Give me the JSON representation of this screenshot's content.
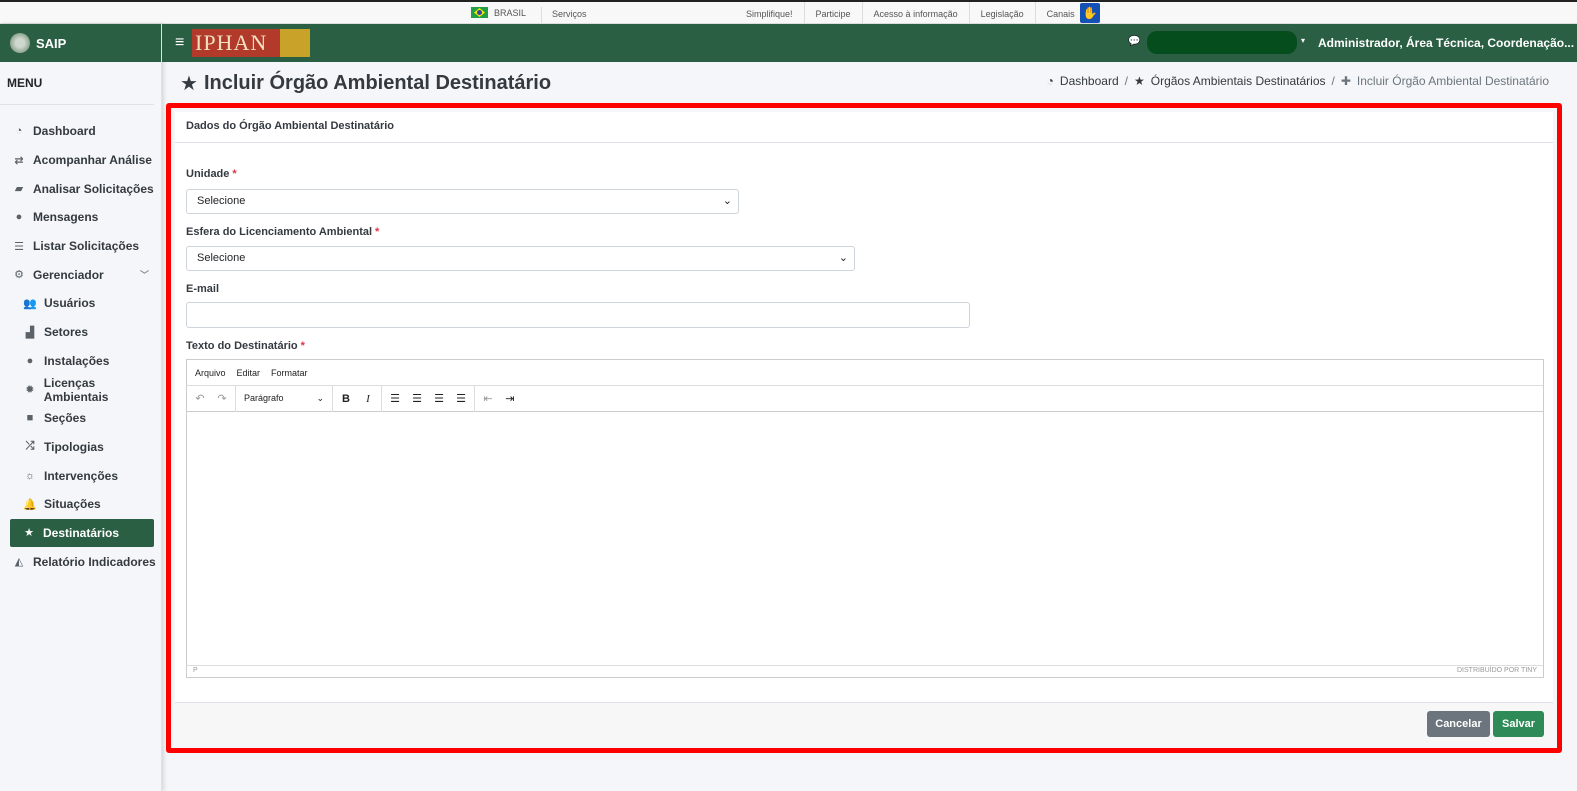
{
  "govbar": {
    "country": "BRASIL",
    "servicos": "Serviços",
    "links": [
      "Simplifique!",
      "Participe",
      "Acesso à informação",
      "Legislação",
      "Canais"
    ]
  },
  "brand": {
    "name": "SAIP"
  },
  "sidebar": {
    "menu_title": "MENU",
    "items": [
      {
        "label": "Dashboard",
        "icon": "dashboard-icon"
      },
      {
        "label": "Acompanhar Análise",
        "icon": "exchange-icon"
      },
      {
        "label": "Analisar Solicitações",
        "icon": "book-icon"
      },
      {
        "label": "Mensagens",
        "icon": "comments-icon"
      },
      {
        "label": "Listar Solicitações",
        "icon": "list-icon"
      },
      {
        "label": "Gerenciador",
        "icon": "cogs-icon"
      },
      {
        "label": "Usuários",
        "icon": "users-icon"
      },
      {
        "label": "Setores",
        "icon": "industry-icon"
      },
      {
        "label": "Instalações",
        "icon": "circle-icon"
      },
      {
        "label": "Licenças Ambientais",
        "icon": "certificate-icon"
      },
      {
        "label": "Seções",
        "icon": "square-icon"
      },
      {
        "label": "Tipologias",
        "icon": "random-icon"
      },
      {
        "label": "Intervenções",
        "icon": "spinner-icon"
      },
      {
        "label": "Situações",
        "icon": "bell-icon"
      },
      {
        "label": "Destinatários",
        "icon": "star-icon"
      },
      {
        "label": "Relatório Indicadores",
        "icon": "area-chart-icon"
      }
    ]
  },
  "topnav": {
    "logo_text": "IPHAN",
    "user": "Administrador, Área Técnica, Coordenação..."
  },
  "page": {
    "title": "Incluir Órgão Ambiental Destinatário",
    "breadcrumb": [
      "Dashboard",
      "Órgãos Ambientais Destinatários",
      "Incluir Órgão Ambiental Destinatário"
    ]
  },
  "form": {
    "card_title": "Dados do Órgão Ambiental Destinatário",
    "unidade_label": "Unidade",
    "unidade_value": "Selecione",
    "esfera_label": "Esfera do Licenciamento Ambiental",
    "esfera_value": "Selecione",
    "email_label": "E-mail",
    "email_value": "",
    "texto_label": "Texto do Destinatário",
    "required_mark": "*"
  },
  "editor": {
    "menus": [
      "Arquivo",
      "Editar",
      "Formatar"
    ],
    "block_format": "Parágrafo",
    "status_path": "P",
    "powered_by": "DISTRIBUÍDO POR TINY"
  },
  "buttons": {
    "cancel": "Cancelar",
    "save": "Salvar"
  },
  "colors": {
    "brand_green": "#2b5f44",
    "highlight": "#ff0000",
    "save": "#2e8b57",
    "cancel": "#6c757d"
  }
}
